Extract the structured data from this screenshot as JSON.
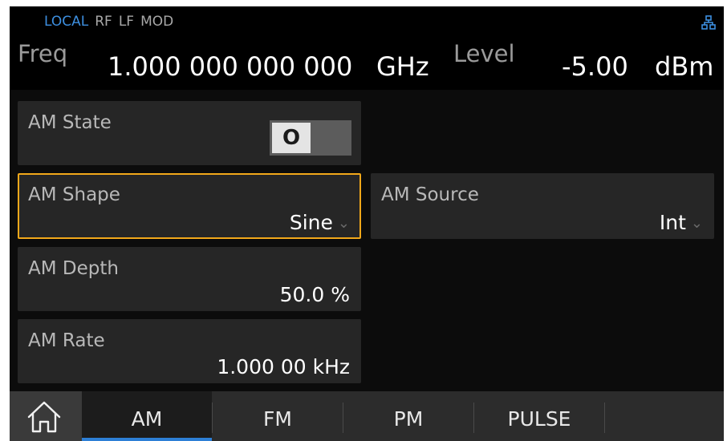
{
  "status": {
    "flags": [
      "LOCAL",
      "RF",
      "LF",
      "MOD"
    ],
    "active_flag": "LOCAL",
    "network_icon": "network-icon"
  },
  "header": {
    "freq_label": "Freq",
    "freq_value": "1.000 000 000 000",
    "freq_unit": "GHz",
    "level_label": "Level",
    "level_value": "-5.00",
    "level_unit": "dBm"
  },
  "params": {
    "am_state": {
      "label": "AM State",
      "value": "O"
    },
    "am_shape": {
      "label": "AM Shape",
      "value": "Sine"
    },
    "am_source": {
      "label": "AM Source",
      "value": "Int"
    },
    "am_depth": {
      "label": "AM Depth",
      "value": "50.0 %"
    },
    "am_rate": {
      "label": "AM Rate",
      "value": "1.000 00 kHz"
    }
  },
  "tabs": [
    {
      "label": "AM",
      "active": true
    },
    {
      "label": "FM",
      "active": false
    },
    {
      "label": "PM",
      "active": false
    },
    {
      "label": "PULSE",
      "active": false
    }
  ],
  "colors": {
    "accent_blue": "#3d8fe0",
    "selection": "#f2a81a",
    "tab_underline": "#2d7fd6"
  }
}
